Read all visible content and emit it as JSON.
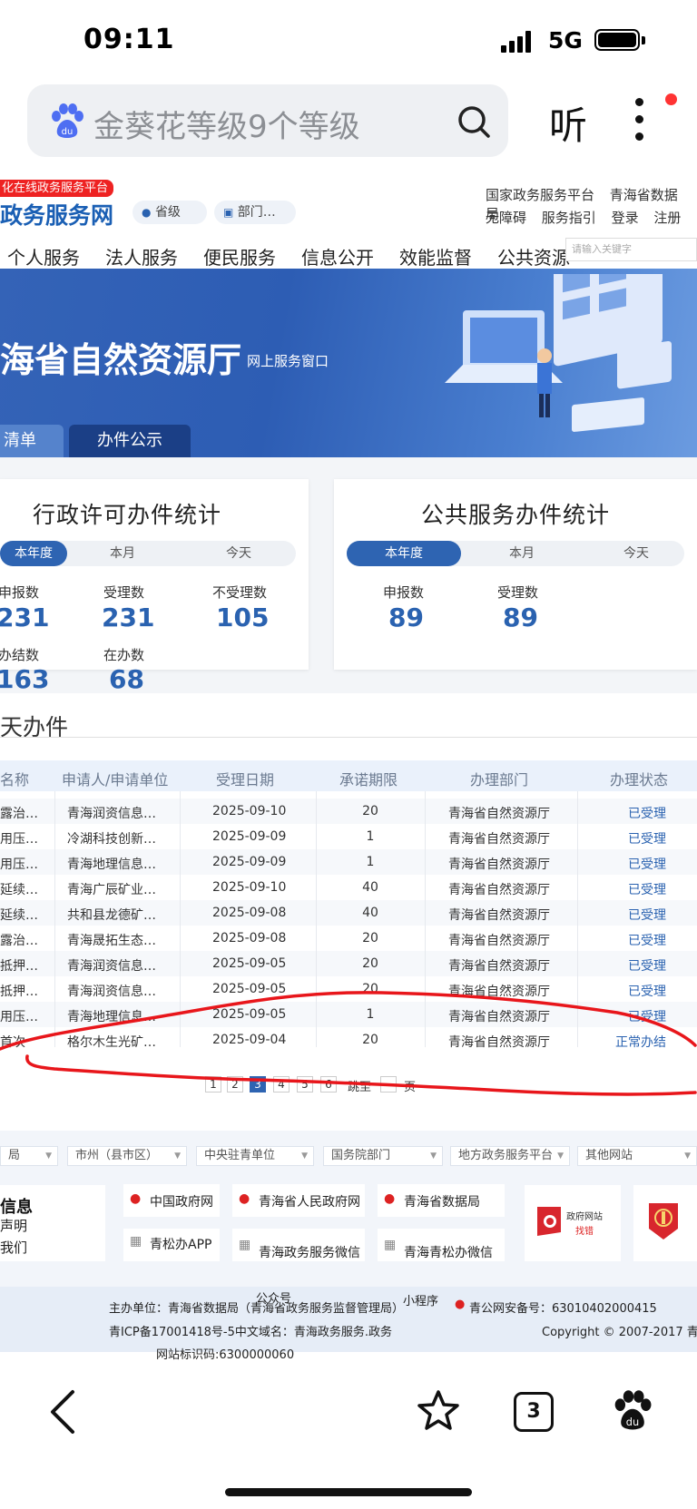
{
  "status_bar": {
    "time": "09:11",
    "network": "5G"
  },
  "search_bar": {
    "query": "金葵花等级9个等级",
    "listen_label": "听"
  },
  "site": {
    "tag": "化在线政务服务平台",
    "title": "政务服务网",
    "region_pill": "省级",
    "dept_pill": "部门…",
    "top_links_row1": [
      "国家政务服务平台",
      "青海省数据局"
    ],
    "top_links_row2": [
      "无障碍",
      "服务指引",
      "登录",
      "注册"
    ],
    "nav": [
      "个人服务",
      "法人服务",
      "便民服务",
      "信息公开",
      "效能监督",
      "公共资源"
    ],
    "nav_search_placeholder": "请输入关键字"
  },
  "banner": {
    "title": "海省自然资源厅",
    "subtitle": "网上服务窗口",
    "tab_list": "清单",
    "tab_public": "办件公示"
  },
  "admin_stats": {
    "title": "行政许可办件统计",
    "tabs": [
      "本年度",
      "本月",
      "今天"
    ],
    "labels": {
      "apply": "申报数",
      "accept": "受理数",
      "reject": "不受理数",
      "done": "办结数",
      "inprogress": "在办数"
    },
    "values": {
      "apply": "231",
      "accept": "231",
      "reject": "105",
      "done": "163",
      "inprogress": "68"
    }
  },
  "public_stats": {
    "title": "公共服务办件统计",
    "tabs": [
      "本年度",
      "本月",
      "今天"
    ],
    "labels": {
      "apply": "申报数",
      "accept": "受理数"
    },
    "values": {
      "apply": "89",
      "accept": "89"
    }
  },
  "today_section_title": "天办件",
  "table": {
    "headers": [
      "名称",
      "申请人/申请单位",
      "受理日期",
      "承诺期限",
      "办理部门",
      "办理状态"
    ],
    "rows": [
      [
        "露治…",
        "青海润资信息…",
        "2025-09-10",
        "20",
        "青海省自然资源厅",
        "已受理"
      ],
      [
        "用压…",
        "冷湖科技创新…",
        "2025-09-09",
        "1",
        "青海省自然资源厅",
        "已受理"
      ],
      [
        "用压…",
        "青海地理信息…",
        "2025-09-09",
        "1",
        "青海省自然资源厅",
        "已受理"
      ],
      [
        "延续…",
        "青海广辰矿业…",
        "2025-09-10",
        "40",
        "青海省自然资源厅",
        "已受理"
      ],
      [
        "延续…",
        "共和县龙德矿…",
        "2025-09-08",
        "40",
        "青海省自然资源厅",
        "已受理"
      ],
      [
        "露治…",
        "青海晟拓生态…",
        "2025-09-08",
        "20",
        "青海省自然资源厅",
        "已受理"
      ],
      [
        "抵押…",
        "青海润资信息…",
        "2025-09-05",
        "20",
        "青海省自然资源厅",
        "已受理"
      ],
      [
        "抵押…",
        "青海润资信息…",
        "2025-09-05",
        "20",
        "青海省自然资源厅",
        "已受理"
      ],
      [
        "用压…",
        "青海地理信息…",
        "2025-09-05",
        "1",
        "青海省自然资源厅",
        "已受理"
      ],
      [
        "首次",
        "格尔木生光矿…",
        "2025-09-04",
        "20",
        "青海省自然资源厅",
        "正常办结"
      ]
    ]
  },
  "pagination": {
    "pages": [
      "1",
      "2",
      "3",
      "4",
      "5",
      "6"
    ],
    "current": "3",
    "jump_label": "跳至",
    "page_unit": "页"
  },
  "footer": {
    "dropdowns": [
      "局",
      "市州（县市区）",
      "中央驻青单位",
      "国务院部门",
      "地方政务服务平台",
      "其他网站"
    ],
    "info_title": "信息",
    "info_links": [
      "声明",
      "我们"
    ],
    "gov_links": [
      "中国政府网",
      "青海省人民政府网",
      "青海省数据局"
    ],
    "app_links": [
      "青松办APP",
      "青海政务服务微信",
      "青海青松办微信"
    ],
    "mini_program": "小程序",
    "wechat_label": "公众号",
    "error_badge": {
      "line1": "政府网站",
      "line2": "找错"
    },
    "sponsor": "主办单位：青海省数据局（青海省政务服务监督管理局）",
    "police": "青公网安备号：63010402000415",
    "icp": "青ICP备17001418号-5中文域名：青海政务服务.政务",
    "copyright": "Copyright © 2007-2017 青海省",
    "site_code": "网站标识码:6300000060"
  },
  "browser_toolbar": {
    "tab_count": "3"
  },
  "annotation_color": "#e8161b"
}
